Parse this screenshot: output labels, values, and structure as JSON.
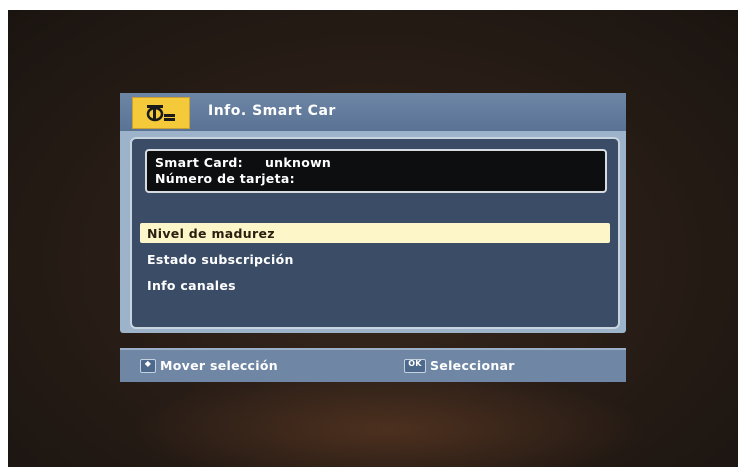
{
  "dialog": {
    "title": "Info. Smart Car",
    "icon": "smart-card-icon",
    "info": {
      "card_label": "Smart Card:",
      "card_value": "unknown",
      "number_label": "Número de tarjeta:"
    },
    "menu": [
      {
        "label": "Nivel de madurez",
        "selected": true
      },
      {
        "label": "Estado subscripción",
        "selected": false
      },
      {
        "label": "Info canales",
        "selected": false
      }
    ]
  },
  "helpbar": {
    "move_label": "Mover selección",
    "select_label": "Seleccionar",
    "move_key_icon": "arrow-keys-icon",
    "select_key_icon": "ok-key-icon",
    "ok_key_text": "OK"
  },
  "colors": {
    "header": "#5a7394",
    "selection": "#fdf6c8",
    "icon_box": "#f4c93a",
    "panel": "#3b4c66"
  }
}
